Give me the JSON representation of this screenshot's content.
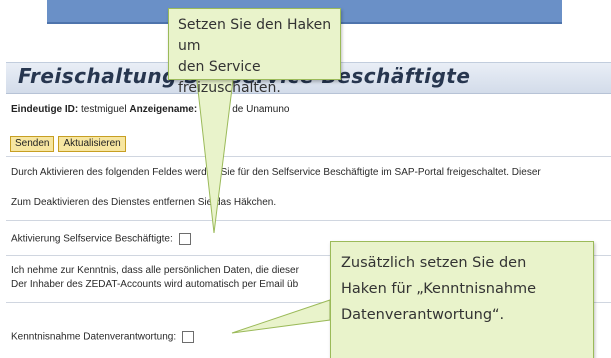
{
  "page": {
    "title": "Freischaltung Selfservice Beschäftigte",
    "id_label": "Eindeutige ID:",
    "id_value": "testmiguel",
    "display_label": "Anzeigename:",
    "display_value": "Miguel de Unamuno"
  },
  "toolbar": {
    "send_label": "Senden",
    "refresh_label": "Aktualisieren"
  },
  "content": {
    "intro_line": "Durch Aktivieren des folgenden Feldes werden Sie für den Selfservice Beschäftigte im SAP-Portal freigeschaltet. Dieser",
    "deactivate_line": "Zum Deaktivieren des Dienstes entfernen Sie das Häkchen.",
    "activation_label": "Aktivierung Selfservice Beschäftigte:",
    "notice_line_1": "Ich nehme zur Kenntnis, dass alle persönlichen Daten, die dieser",
    "notice_line_2": "Der Inhaber des ZEDAT-Accounts wird automatisch per Email üb",
    "acknowledge_label": "Kenntnisnahme Datenverantwortung:"
  },
  "callouts": {
    "first": [
      "Setzen Sie den Haken um",
      "den Service freizuschalten."
    ],
    "second": [
      "Zusätzlich setzen Sie den",
      "Haken für „Kenntnisnahme",
      "Datenverantwortung“."
    ]
  },
  "colors": {
    "callout_fill": "#e9f3cb",
    "callout_border": "#9bba59",
    "button_fill": "#f7e6a1",
    "title_text": "#27364f"
  }
}
